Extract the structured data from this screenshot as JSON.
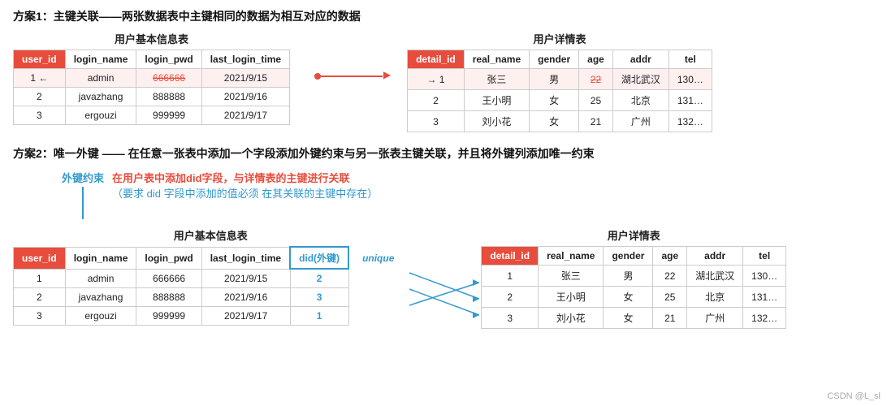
{
  "section1": {
    "title": "方案1：主键关联——两张数据表中主键相同的数据为相互对应的数据",
    "left_table": {
      "label": "用户基本信息表",
      "headers": [
        "user_id",
        "login_name",
        "login_pwd",
        "last_login_time"
      ],
      "rows": [
        [
          "1",
          "admin",
          "666666",
          "2021/9/15"
        ],
        [
          "2",
          "javazhang",
          "888888",
          "2021/9/16"
        ],
        [
          "3",
          "ergouzi",
          "999999",
          "2021/9/17"
        ]
      ]
    },
    "right_table": {
      "label": "用户详情表",
      "headers": [
        "detail_id",
        "real_name",
        "gender",
        "age",
        "addr",
        "tel"
      ],
      "rows": [
        [
          "1",
          "张三",
          "男",
          "22",
          "湖北武汉",
          "130…"
        ],
        [
          "2",
          "王小明",
          "女",
          "25",
          "北京",
          "131…"
        ],
        [
          "3",
          "刘小花",
          "女",
          "21",
          "广州",
          "132…"
        ]
      ]
    }
  },
  "section2": {
    "title": "方案2：唯一外键 —— 在任意一张表中添加一个字段添加外键约束与另一张表主键关联，并且将外键列添加唯一约束",
    "fk_label": "外键约束",
    "fk_desc_line1": "在用户表中添加did字段，与详情表的主键进行关联",
    "fk_desc_line2": "（要求 did 字段中添加的值必须 在其关联的主键中存在）",
    "left_table": {
      "label": "用户基本信息表",
      "headers": [
        "user_id",
        "login_name",
        "login_pwd",
        "last_login_time",
        "did(外键)",
        "unique"
      ],
      "rows": [
        [
          "1",
          "admin",
          "666666",
          "2021/9/15",
          "2",
          ""
        ],
        [
          "2",
          "javazhang",
          "888888",
          "2021/9/16",
          "3",
          ""
        ],
        [
          "3",
          "ergouzi",
          "999999",
          "2021/9/17",
          "1",
          ""
        ]
      ]
    },
    "right_table": {
      "label": "用户详情表",
      "headers": [
        "detail_id",
        "real_name",
        "gender",
        "age",
        "addr",
        "tel"
      ],
      "rows": [
        [
          "1",
          "张三",
          "男",
          "22",
          "湖北武汉",
          "130…"
        ],
        [
          "2",
          "王小明",
          "女",
          "25",
          "北京",
          "131…"
        ],
        [
          "3",
          "刘小花",
          "女",
          "21",
          "广州",
          "132…"
        ]
      ]
    }
  },
  "watermark": "CSDN @L_sl"
}
